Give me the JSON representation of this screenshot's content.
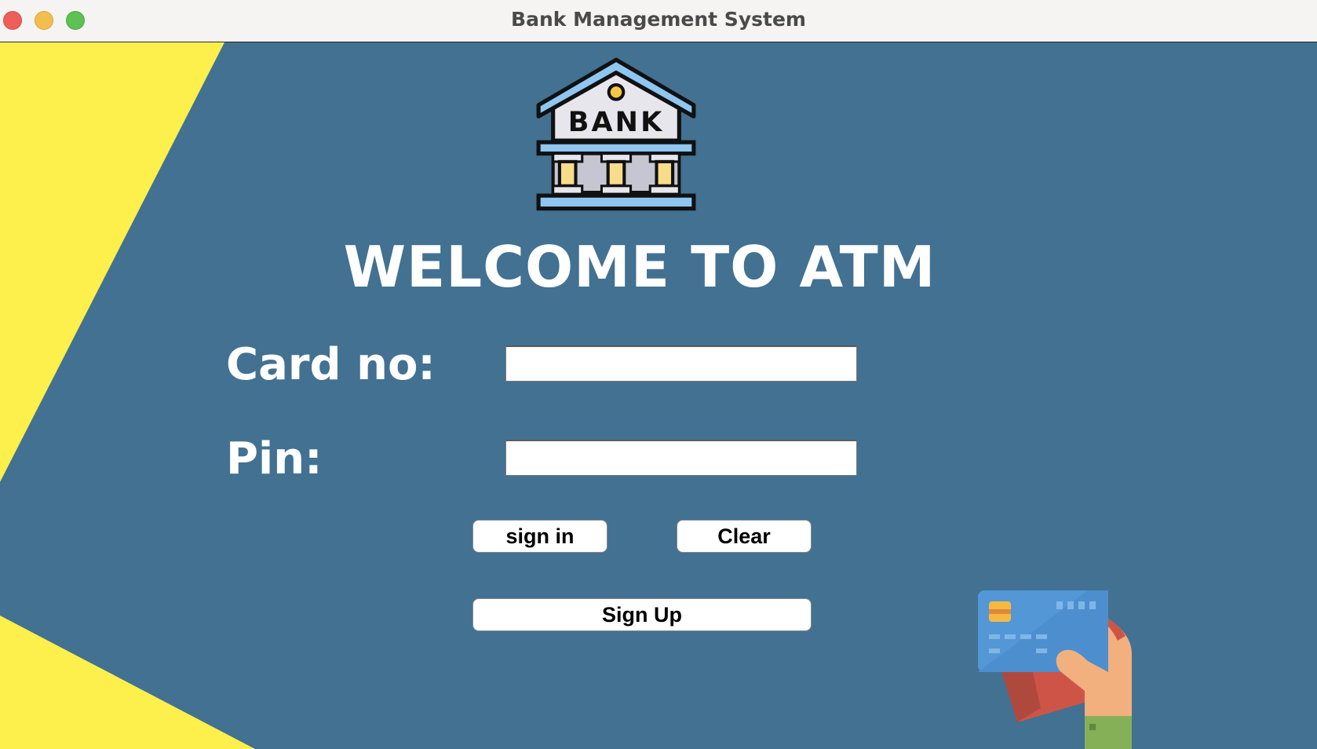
{
  "window": {
    "title": "Bank Management System",
    "controls": [
      "close",
      "minimize",
      "zoom"
    ]
  },
  "header": {
    "logo_text": "BANK",
    "logo_icon": "bank-building-icon",
    "welcome": "WELCOME TO ATM"
  },
  "form": {
    "card_label": "Card no:",
    "card_value": "",
    "pin_label": "Pin:",
    "pin_value": ""
  },
  "buttons": {
    "signin": "sign in",
    "clear": "Clear",
    "signup": "Sign Up"
  },
  "decor": {
    "card_hand_icon": "hand-holding-credit-card-icon"
  },
  "colors": {
    "background": "#427192",
    "accent_yellow": "#fdef4c",
    "titlebar": "#f5f4f3"
  }
}
